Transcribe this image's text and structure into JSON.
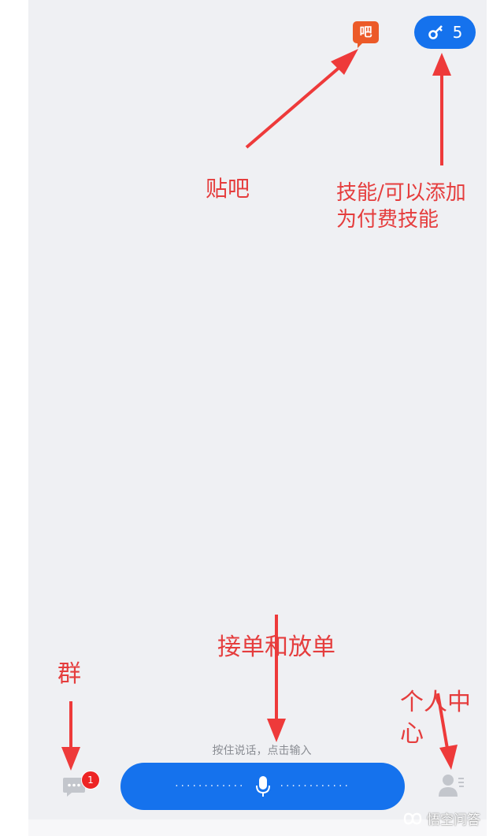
{
  "top_bar": {
    "tieba_icon_text": "吧",
    "skill_count": "5"
  },
  "annotations": {
    "tieba": "贴吧",
    "skills": "技能/可以添加\n为付费技能",
    "order": "接单和放单",
    "group": "群",
    "personal_center": "个人中\n心"
  },
  "bottom_bar": {
    "voice_hint": "按住说话，点击输入",
    "group_badge_count": "1",
    "voice_dots": "············"
  },
  "watermark": "悟空问答",
  "colors": {
    "accent_blue": "#1572ed",
    "tieba_orange": "#ec5a28",
    "annotation_red": "#e53d3d",
    "badge_red": "#ed2424"
  },
  "icons": [
    "tieba-icon",
    "key-icon",
    "microphone-icon",
    "chat-bubble-icon",
    "profile-icon",
    "wukong-logo-icon"
  ]
}
